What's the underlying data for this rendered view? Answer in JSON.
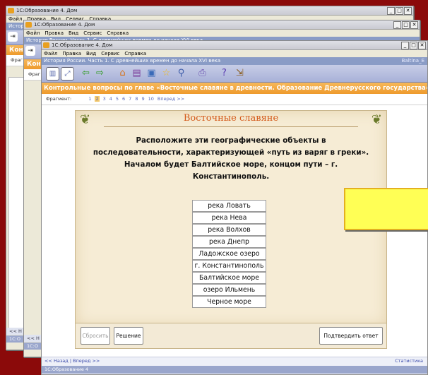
{
  "window1": {
    "title": "1С:Образование 4. Дом",
    "menu": [
      "Файл",
      "Правка",
      "Вид",
      "Сервис",
      "Справка"
    ],
    "bluebar": "История",
    "orange_fragment": "Кон",
    "frag_label": "Фраг",
    "status_bottom": "<< Н",
    "status_app": "1С:О"
  },
  "window2": {
    "title": "1С:Образование 4. Дом",
    "menu": [
      "Файл",
      "Правка",
      "Вид",
      "Сервис",
      "Справка"
    ],
    "bluebar": "История России. Часть 1. С древнейших времен до начала XVI века",
    "orange_fragment": "Кон",
    "frag_label": "Фраг",
    "status_bottom": "<< Н",
    "status_app": "1С:О"
  },
  "window3": {
    "title": "1С:Образование 4. Дом",
    "menu": [
      "Файл",
      "Правка",
      "Вид",
      "Сервис",
      "Справка"
    ],
    "course_title": "История России. Часть 1. С древнейших времен до начала XVI века",
    "user": "Baltina_E",
    "section_title": "Контрольные вопросы по главе «Восточные славяне в древности. Образование Древнерусского государства»",
    "fragment_label": "Фрагмент:",
    "fragments": [
      "1",
      "2",
      "3",
      "4",
      "5",
      "6",
      "7",
      "8",
      "9",
      "10"
    ],
    "fragment_next": "Вперед >>",
    "card_title": "Восточные славяне",
    "question": "Расположите эти географические объекты в последовательности, характеризующей «путь из варяг в греки». Началом будет Балтийское море, концом пути – г. Константинополь.",
    "items": [
      "река Ловать",
      "река Нева",
      "река Волхов",
      "река Днепр",
      "Ладожское озеро",
      "г. Константинополь",
      "Балтийское море",
      "озеро Ильмень",
      "Черное море"
    ],
    "buttons": {
      "reset": "Сбросить",
      "solution": "Решение",
      "confirm": "Подтвердить ответ"
    },
    "nav": "<< Назад  | Вперед >>",
    "stats": "Статистика",
    "status_app": "1С:Образование 4"
  },
  "colors": {
    "background": "#8b0a0a",
    "section_bar": "#ee9a2c",
    "card": "#f6ecd5",
    "title_accent": "#d45a1a",
    "hint_box": "#ffff55"
  },
  "icons": [
    "back-arrow-icon",
    "forward-arrow-icon",
    "home-icon",
    "library-icon",
    "bookmark-icon",
    "favorite-star-icon",
    "search-icon",
    "print-icon",
    "help-icon",
    "exit-icon"
  ]
}
